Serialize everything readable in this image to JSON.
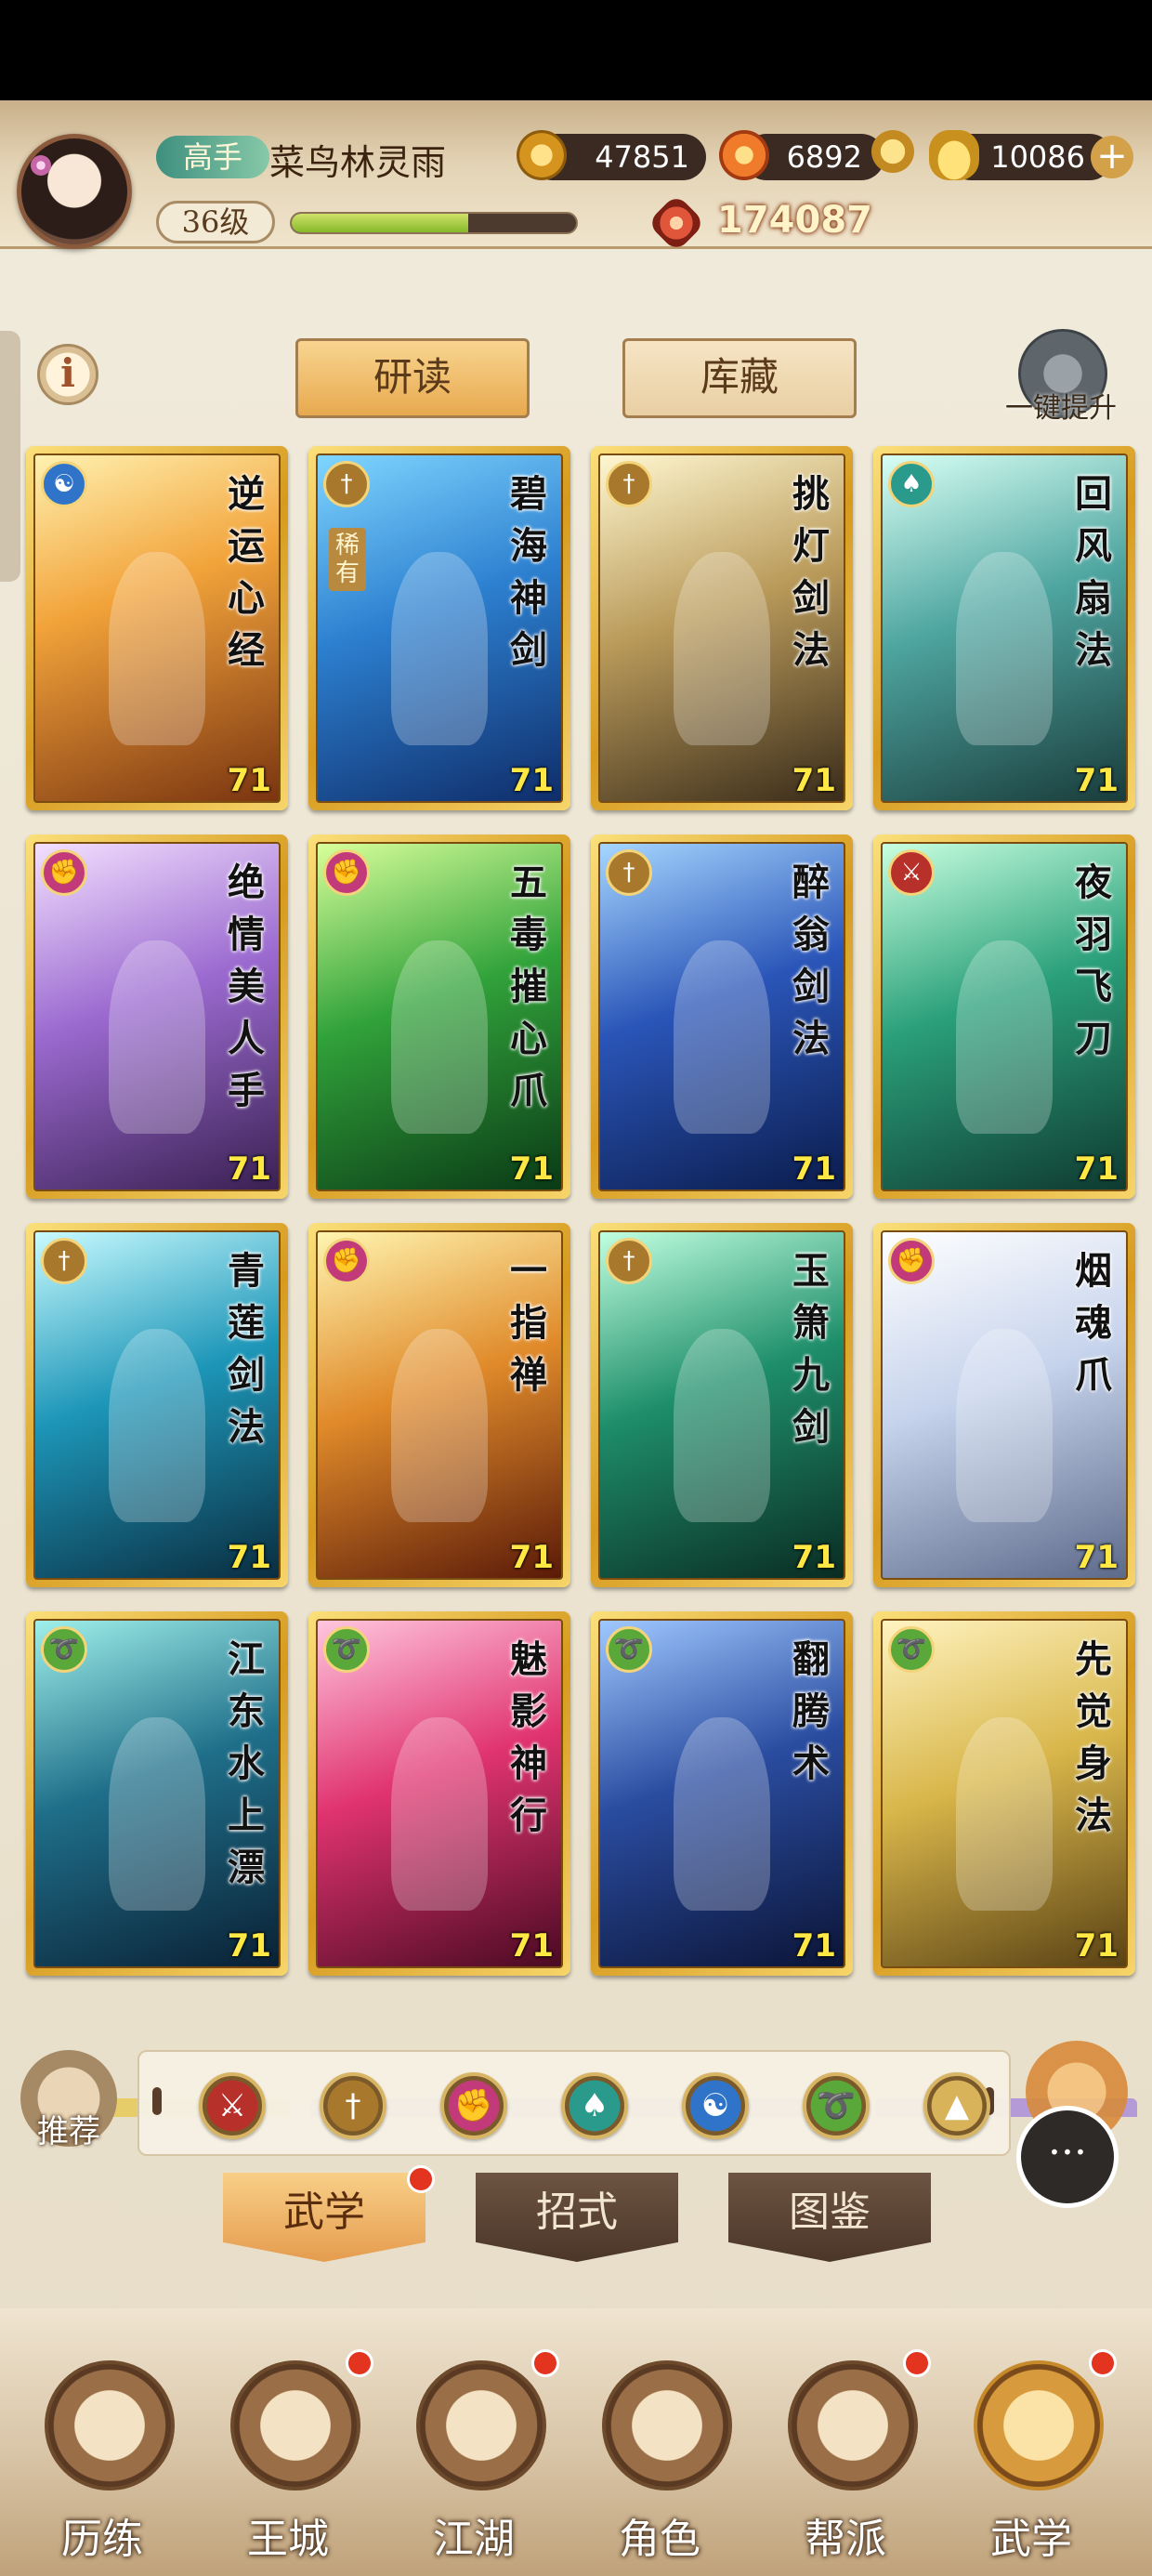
{
  "header": {
    "rank": "高手",
    "player_name": "菜鸟林灵雨",
    "level": "36级",
    "exp_fraction": 0.62,
    "coins": "47851",
    "flames": "6892",
    "ingots": "10086",
    "power": "174087"
  },
  "controls": {
    "info": "i",
    "tab_study": "研读",
    "tab_storage": "库藏",
    "upgrade_label": "一键提升"
  },
  "cards": [
    {
      "name": "逆运心经",
      "level": "71",
      "school": "yinyang",
      "rare": ""
    },
    {
      "name": "碧海神剑",
      "level": "71",
      "school": "sword",
      "rare": "稀有"
    },
    {
      "name": "挑灯剑法",
      "level": "71",
      "school": "sword",
      "rare": ""
    },
    {
      "name": "回风扇法",
      "level": "71",
      "school": "fan",
      "rare": ""
    },
    {
      "name": "绝情美人手",
      "level": "71",
      "school": "fist",
      "rare": ""
    },
    {
      "name": "五毒摧心爪",
      "level": "71",
      "school": "fist",
      "rare": ""
    },
    {
      "name": "醉翁剑法",
      "level": "71",
      "school": "sword",
      "rare": ""
    },
    {
      "name": "夜羽飞刀",
      "level": "71",
      "school": "blade",
      "rare": ""
    },
    {
      "name": "青莲剑法",
      "level": "71",
      "school": "sword",
      "rare": ""
    },
    {
      "name": "一指禅",
      "level": "71",
      "school": "fist",
      "rare": ""
    },
    {
      "name": "玉箫九剑",
      "level": "71",
      "school": "sword",
      "rare": ""
    },
    {
      "name": "烟魂爪",
      "level": "71",
      "school": "fist",
      "rare": ""
    },
    {
      "name": "江东水上漂",
      "level": "71",
      "school": "movement",
      "rare": ""
    },
    {
      "name": "魅影神行",
      "level": "71",
      "school": "movement",
      "rare": ""
    },
    {
      "name": "翻腾术",
      "level": "71",
      "school": "movement",
      "rare": ""
    },
    {
      "name": "先觉身法",
      "level": "71",
      "school": "movement",
      "rare": ""
    }
  ],
  "filter": {
    "recommend_label": "推荐",
    "icons": [
      "blade-filter-icon",
      "sword-filter-icon",
      "fist-filter-icon",
      "fan-filter-icon",
      "yinyang-filter-icon",
      "movement-filter-icon",
      "special-filter-icon"
    ]
  },
  "sub_tabs": [
    "武学",
    "招式",
    "图鉴"
  ],
  "nav": [
    "历练",
    "王城",
    "江湖",
    "角色",
    "帮派",
    "武学"
  ],
  "colors": {
    "yinyang": "#2f74c9",
    "sword": "#a8792c",
    "fan": "#2a9a8c",
    "fist": "#c23a7a",
    "blade": "#b8302a",
    "movement": "#5aa83a",
    "special": "#d9b35a"
  }
}
